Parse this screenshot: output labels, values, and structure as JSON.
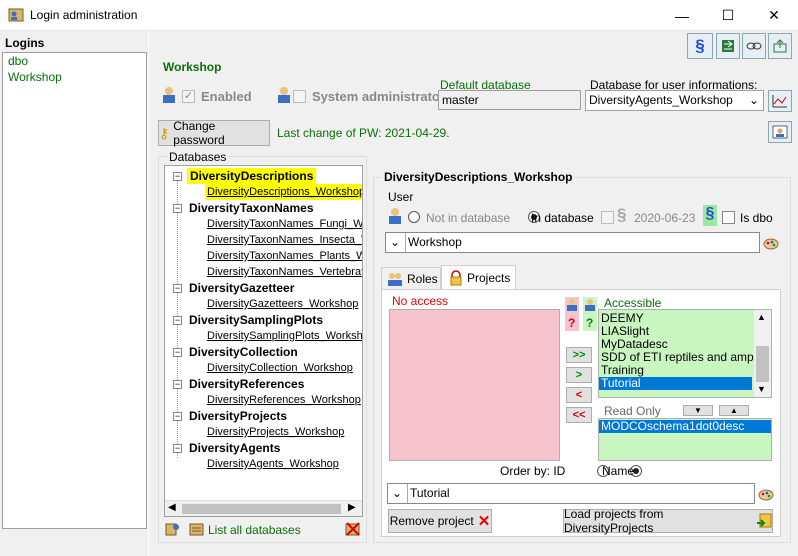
{
  "window": {
    "title": "Login administration",
    "minimize": "—",
    "maximize": "☐",
    "close": "✕"
  },
  "logins": {
    "label": "Logins",
    "items": [
      "dbo",
      "Workshop"
    ]
  },
  "header": {
    "login_name": "Workshop",
    "enabled_label": "Enabled",
    "sysadmin_label": "System administrator",
    "default_db_label": "Default database",
    "default_db_value": "master",
    "userinfo_db_label": "Database for user informations:",
    "userinfo_db_value": "DiversityAgents_Workshop"
  },
  "password": {
    "button": "Change password",
    "last_change": "Last change of PW: 2021-04-29."
  },
  "databases": {
    "label": "Databases",
    "groups": [
      {
        "name": "DiversityDescriptions",
        "children": [
          "DiversityDescriptions_Workshop"
        ]
      },
      {
        "name": "DiversityTaxonNames",
        "children": [
          "DiversityTaxonNames_Fungi_Wo",
          "DiversityTaxonNames_Insecta_W",
          "DiversityTaxonNames_Plants_Wo",
          "DiversityTaxonNames_Vertebrat"
        ]
      },
      {
        "name": "DiversityGazetteer",
        "children": [
          "DiversityGazetteers_Workshop"
        ]
      },
      {
        "name": "DiversitySamplingPlots",
        "children": [
          "DiversitySamplingPlots_Workshop"
        ]
      },
      {
        "name": "DiversityCollection",
        "children": [
          "DiversityCollection_Workshop"
        ]
      },
      {
        "name": "DiversityReferences",
        "children": [
          "DiversityReferences_Workshop"
        ]
      },
      {
        "name": "DiversityProjects",
        "children": [
          "DiversityProjects_Workshop"
        ]
      },
      {
        "name": "DiversityAgents",
        "children": [
          "DiversityAgents_Workshop"
        ]
      }
    ],
    "list_all": "List all databases"
  },
  "detail": {
    "db_title": "DiversityDescriptions_Workshop",
    "user_label": "User",
    "not_in_db": "Not in database",
    "in_db": "In database",
    "date": "2020-06-23",
    "is_dbo": "Is dbo",
    "user_value": "Workshop"
  },
  "tabs": {
    "roles": "Roles",
    "projects": "Projects"
  },
  "projects": {
    "no_access_label": "No access",
    "accessible_label": "Accessible",
    "accessible_items": [
      "DEEMY",
      "LIASlight",
      "MyDatadesc",
      "SDD of ETI reptiles and amphibi",
      "Training",
      "Tutorial"
    ],
    "selected": "Tutorial",
    "readonly_label": "Read Only",
    "readonly_items": [
      "MODCOschema1dot0desc"
    ],
    "order_by": "Order by: ID",
    "order_name": "Name",
    "project_value": "Tutorial",
    "remove_button": "Remove project",
    "load_button": "Load projects from DiversityProjects",
    "btn_all_right": ">>",
    "btn_right": ">",
    "btn_left": "<",
    "btn_all_left": "<<"
  },
  "colors": {
    "green_text": "#0a6e0a",
    "highlight": "#ffff00",
    "selection": "#0078d7",
    "no_access_bg": "#f7c4cd",
    "accessible_bg": "#c8f5c0"
  }
}
